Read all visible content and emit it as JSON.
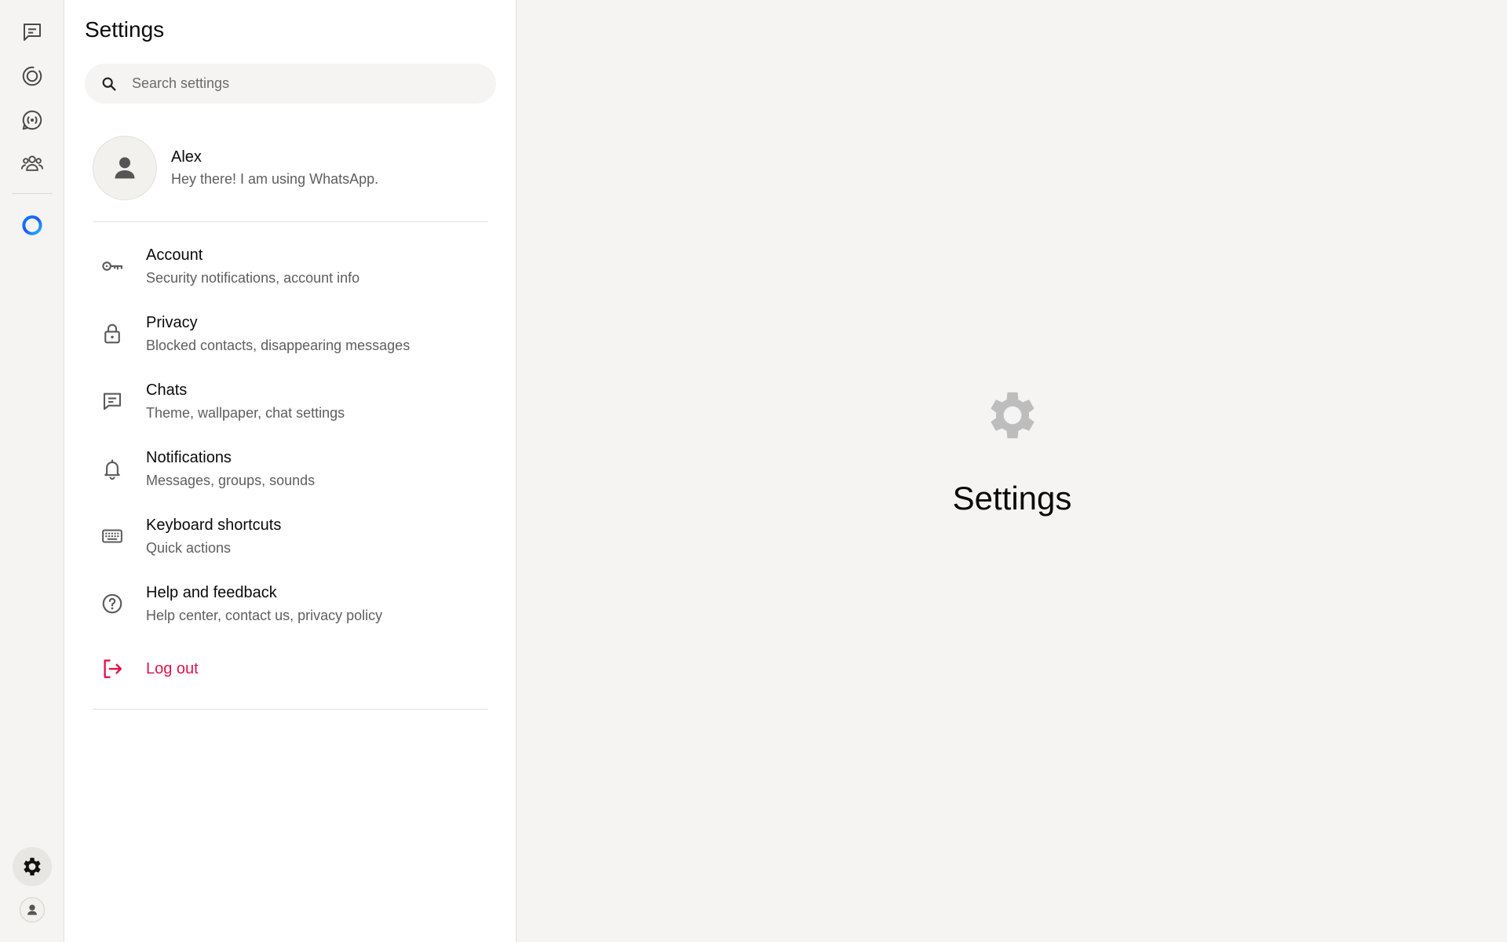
{
  "rail": {
    "items": [
      {
        "name": "chats",
        "icon": "chat-icon"
      },
      {
        "name": "status",
        "icon": "status-icon"
      },
      {
        "name": "channels",
        "icon": "channels-icon"
      },
      {
        "name": "communities",
        "icon": "communities-icon"
      },
      {
        "name": "meta-ai",
        "icon": "meta-ai-ring-icon"
      }
    ],
    "bottom": [
      {
        "name": "settings",
        "icon": "gear-icon",
        "active": true
      },
      {
        "name": "profile",
        "icon": "avatar-icon"
      }
    ]
  },
  "panel": {
    "title": "Settings",
    "search": {
      "placeholder": "Search settings",
      "value": ""
    },
    "profile": {
      "name": "Alex",
      "status": "Hey there! I am using WhatsApp."
    },
    "menu": [
      {
        "id": "account",
        "icon": "key-icon",
        "title": "Account",
        "subtitle": "Security notifications, account info"
      },
      {
        "id": "privacy",
        "icon": "lock-icon",
        "title": "Privacy",
        "subtitle": "Blocked contacts, disappearing messages"
      },
      {
        "id": "chats",
        "icon": "chat-icon",
        "title": "Chats",
        "subtitle": "Theme, wallpaper, chat settings"
      },
      {
        "id": "notifications",
        "icon": "bell-icon",
        "title": "Notifications",
        "subtitle": "Messages, groups, sounds"
      },
      {
        "id": "keyboard",
        "icon": "keyboard-icon",
        "title": "Keyboard shortcuts",
        "subtitle": "Quick actions"
      },
      {
        "id": "help",
        "icon": "help-icon",
        "title": "Help and feedback",
        "subtitle": "Help center, contact us, privacy policy"
      }
    ],
    "logout": {
      "icon": "logout-icon",
      "label": "Log out"
    }
  },
  "content": {
    "icon": "gear-icon",
    "title": "Settings"
  },
  "colors": {
    "accent_logout": "#e0144c",
    "icon_gray": "#5b5b5b",
    "empty_icon_gray": "#bdbdbd",
    "meta_ring_blue": "#1877f2"
  }
}
